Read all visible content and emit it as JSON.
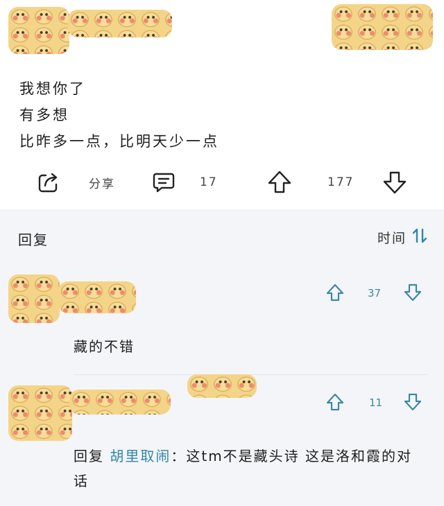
{
  "post": {
    "lines": [
      "我想你了",
      "有多想",
      "比昨多一点，比明天少一点"
    ],
    "actions": {
      "share_label": "分享",
      "comment_count": "17",
      "vote_count": "177"
    }
  },
  "replies": {
    "title": "回复",
    "sort_label": "时间",
    "items": [
      {
        "vote_count": "37",
        "content": "藏的不错"
      },
      {
        "vote_count": "11",
        "reply_prefix": "回复",
        "reply_to": "胡里取闹",
        "content": "：这tm不是藏头诗 这是洛和霞的对话"
      }
    ]
  },
  "colors": {
    "accent": "#2e86a8",
    "vote_icon": "#3a8aa0",
    "replies_background": "#f4f5f9"
  }
}
